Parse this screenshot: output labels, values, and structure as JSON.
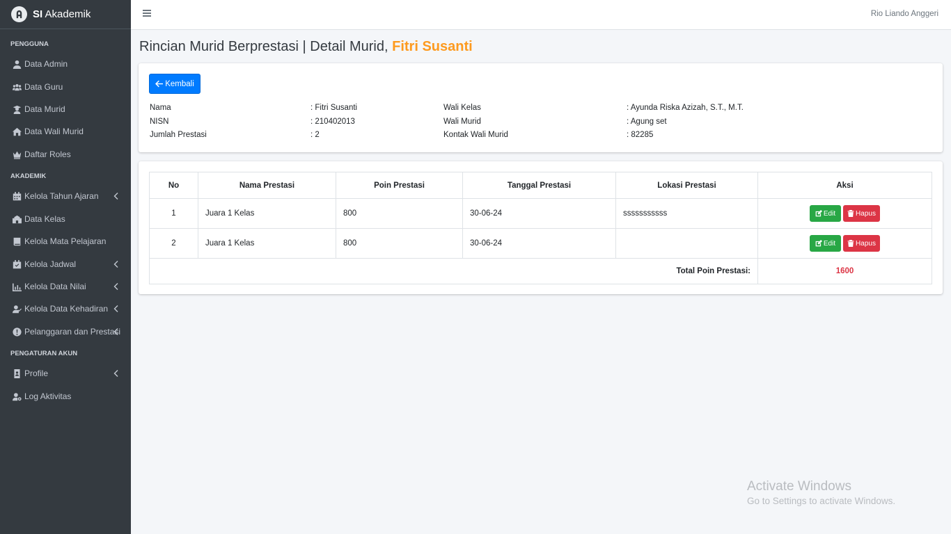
{
  "brand": {
    "bold": "SI",
    "rest": " Akademik"
  },
  "sidebar": {
    "headers": [
      "PENGGUNA",
      "AKADEMIK",
      "PENGATURAN AKUN"
    ],
    "items": [
      {
        "label": "Data Admin",
        "icon": "user-icon"
      },
      {
        "label": "Data Guru",
        "icon": "users-icon"
      },
      {
        "label": "Data Murid",
        "icon": "graduate-icon"
      },
      {
        "label": "Data Wali Murid",
        "icon": "home-icon"
      },
      {
        "label": "Daftar Roles",
        "icon": "crown-icon"
      },
      {
        "label": "Kelola Tahun Ajaran",
        "icon": "calendar-icon"
      },
      {
        "label": "Data Kelas",
        "icon": "school-icon"
      },
      {
        "label": "Kelola Mata Pelajaran",
        "icon": "book-icon"
      },
      {
        "label": "Kelola Jadwal",
        "icon": "calendar-check-icon"
      },
      {
        "label": "Kelola Data Nilai",
        "icon": "chart-icon"
      },
      {
        "label": "Kelola Data Kehadiran",
        "icon": "user-check-icon"
      },
      {
        "label": "Pelanggaran dan Prestasi",
        "icon": "exclamation-icon"
      },
      {
        "label": "Profile",
        "icon": "id-badge-icon"
      },
      {
        "label": "Log Aktivitas",
        "icon": "user-cog-icon"
      }
    ]
  },
  "topbar": {
    "user": "Rio Liando Anggeri"
  },
  "page": {
    "title": "Rincian Murid Berprestasi | Detail Murid, ",
    "student_name": "Fitri Susanti"
  },
  "back_button": "Kembali",
  "info": {
    "left": [
      {
        "label": "Nama",
        "value": ": Fitri Susanti"
      },
      {
        "label": "NISN",
        "value": ": 210402013"
      },
      {
        "label": "Jumlah Prestasi",
        "value": ": 2"
      }
    ],
    "right": [
      {
        "label": "Wali Kelas",
        "value": ": Ayunda Riska Azizah, S.T., M.T."
      },
      {
        "label": "Wali Murid",
        "value": ": Agung set"
      },
      {
        "label": "Kontak Wali Murid",
        "value": ": 82285"
      }
    ]
  },
  "table": {
    "headers": [
      "No",
      "Nama Prestasi",
      "Poin Prestasi",
      "Tanggal Prestasi",
      "Lokasi Prestasi",
      "Aksi"
    ],
    "rows": [
      {
        "no": "1",
        "nama": "Juara 1 Kelas",
        "poin": "800",
        "tanggal": "30-06-24",
        "lokasi": "sssssssssss"
      },
      {
        "no": "2",
        "nama": "Juara 1 Kelas",
        "poin": "800",
        "tanggal": "30-06-24",
        "lokasi": ""
      }
    ],
    "edit_label": "Edit",
    "delete_label": "Hapus",
    "total_label": "Total Poin Prestasi:",
    "total_value": "1600"
  },
  "watermark": {
    "line1": "Activate Windows",
    "line2": "Go to Settings to activate Windows."
  },
  "colors": {
    "sidebar": "#343a40",
    "primary": "#007bff",
    "highlight": "#fd9a1f",
    "success": "#28a745",
    "danger": "#dc3545"
  }
}
